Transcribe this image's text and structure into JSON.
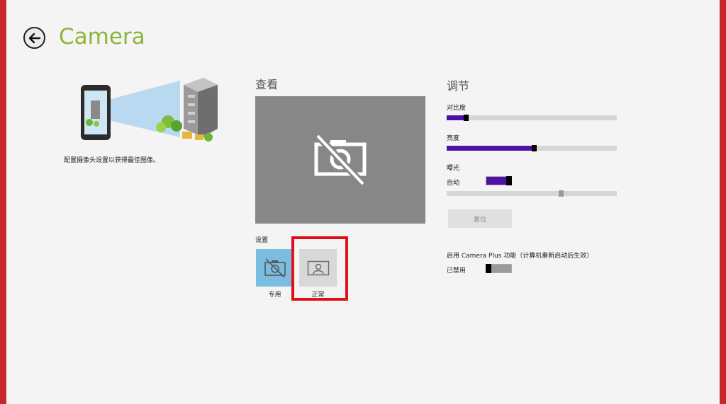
{
  "header": {
    "title": "Camera"
  },
  "left": {
    "description": "配置摄像头设置以获得最佳图像。"
  },
  "view": {
    "heading": "查看",
    "settings_label": "设置",
    "modes": [
      {
        "label": "专用",
        "icon": "camera-off-icon",
        "color": "#7bbde0"
      },
      {
        "label": "正常",
        "icon": "person-frame-icon",
        "color": "#d8d8d8"
      }
    ]
  },
  "adjust": {
    "heading": "调节",
    "contrast_label": "对比度",
    "contrast_value": 0.1,
    "brightness_label": "亮度",
    "brightness_value": 0.5,
    "exposure_label": "曝光",
    "auto_label": "自动",
    "auto_on": true,
    "exposure_value": 0.66,
    "reset_label": "复位",
    "camera_plus_label": "启用 Camera Plus 功能（计算机重新启动后生效）",
    "disabled_label": "已禁用",
    "camera_plus_on": false
  },
  "colors": {
    "accent": "#4c12a6",
    "title": "#8db53a",
    "highlight": "#e0101a"
  }
}
